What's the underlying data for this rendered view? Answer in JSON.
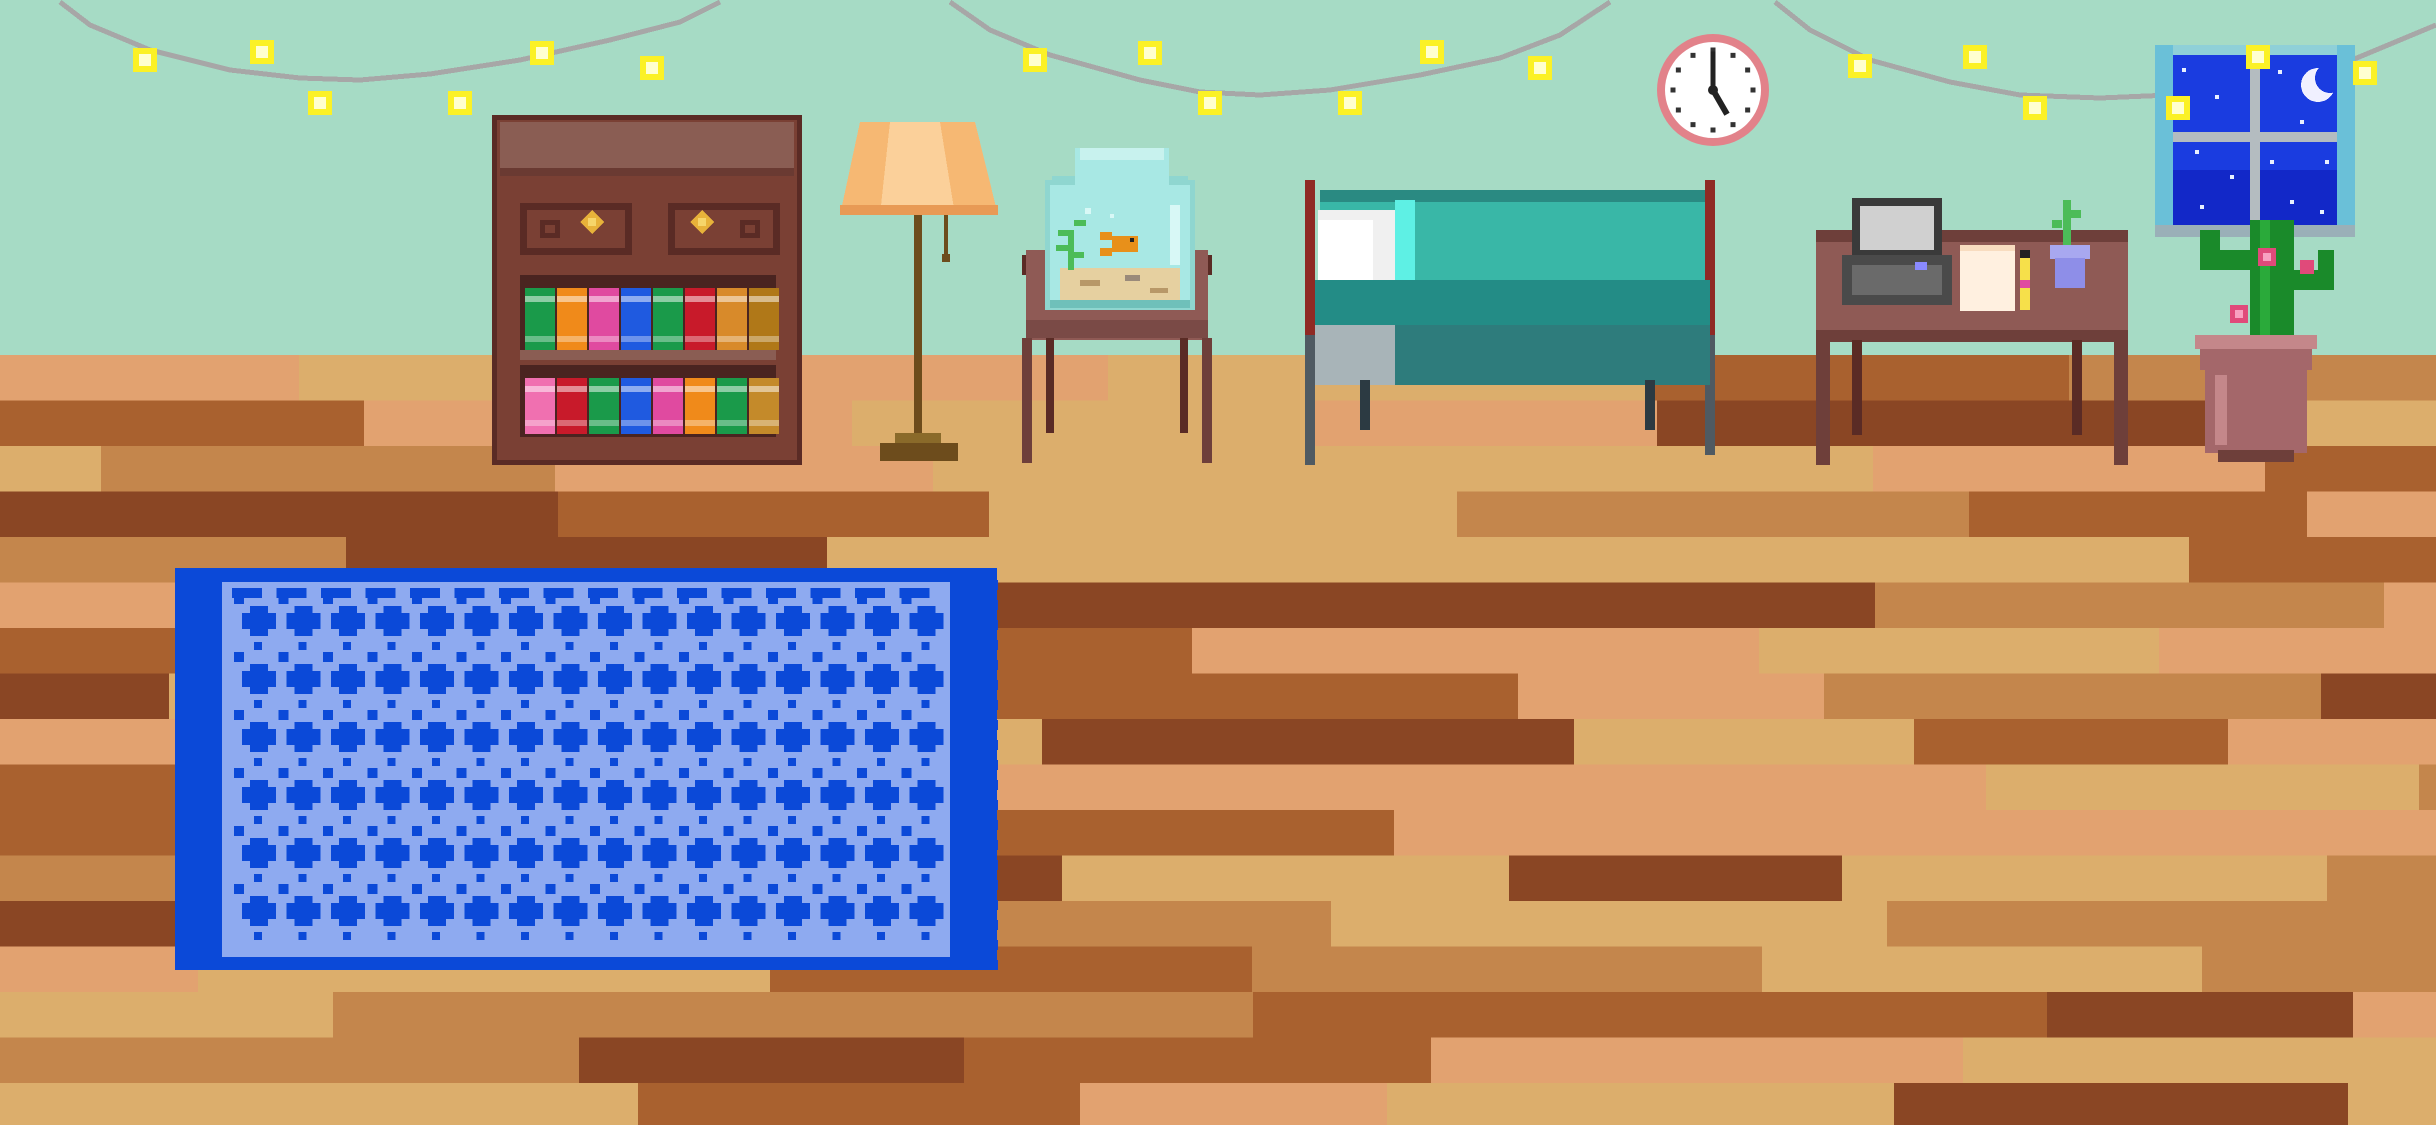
{
  "scene": {
    "name": "pixel-bedroom",
    "time_shown_on_clock": "05:00",
    "colors": {
      "wall": "#a6dbc5",
      "floor_tones": [
        "#e2a270",
        "#a9612f",
        "#dcae6c",
        "#c4864c",
        "#8a4624"
      ],
      "rug_dark": "#0b49d8",
      "rug_light": "#8eaaf0",
      "rug_fringe": "#1346d4",
      "bookshelf": "#7a4034",
      "bookshelf_top": "#8a5d53",
      "bedspread": "#39b7a7",
      "bed_frame": "#8f2a24",
      "fairy_light": "#fbf126",
      "string": "#a7a7a7",
      "clock_rim": "#e2828a",
      "night_sky": "#1a3ce0",
      "desk": "#8f5a55",
      "cactus": "#1a8a2a",
      "cactus_flower": "#e04a7a",
      "pot": "#a4676a",
      "lamp_shade": "#f6b873",
      "fishbowl_glass": "#a8e8e4",
      "goldfish": "#e8901a"
    },
    "objects": [
      {
        "id": "bookshelf",
        "icon": "bookshelf-icon",
        "interactable": true
      },
      {
        "id": "floor-lamp",
        "icon": "lamp-icon",
        "interactable": true
      },
      {
        "id": "fishbowl",
        "icon": "fishbowl-icon",
        "interactable": true
      },
      {
        "id": "bed",
        "icon": "bed-icon",
        "interactable": true
      },
      {
        "id": "wall-clock",
        "icon": "clock-icon",
        "interactable": true
      },
      {
        "id": "desk",
        "icon": "desk-icon",
        "interactable": true
      },
      {
        "id": "computer",
        "icon": "computer-icon",
        "interactable": true
      },
      {
        "id": "notepad",
        "icon": "notepad-icon",
        "interactable": true
      },
      {
        "id": "potted-sprout",
        "icon": "sprout-icon",
        "interactable": true
      },
      {
        "id": "window",
        "icon": "window-icon",
        "interactable": true
      },
      {
        "id": "cactus",
        "icon": "cactus-icon",
        "interactable": true
      },
      {
        "id": "rug",
        "icon": "rug-icon",
        "interactable": true
      },
      {
        "id": "fairy-lights",
        "icon": "fairy-lights-icon",
        "interactable": false
      }
    ]
  }
}
